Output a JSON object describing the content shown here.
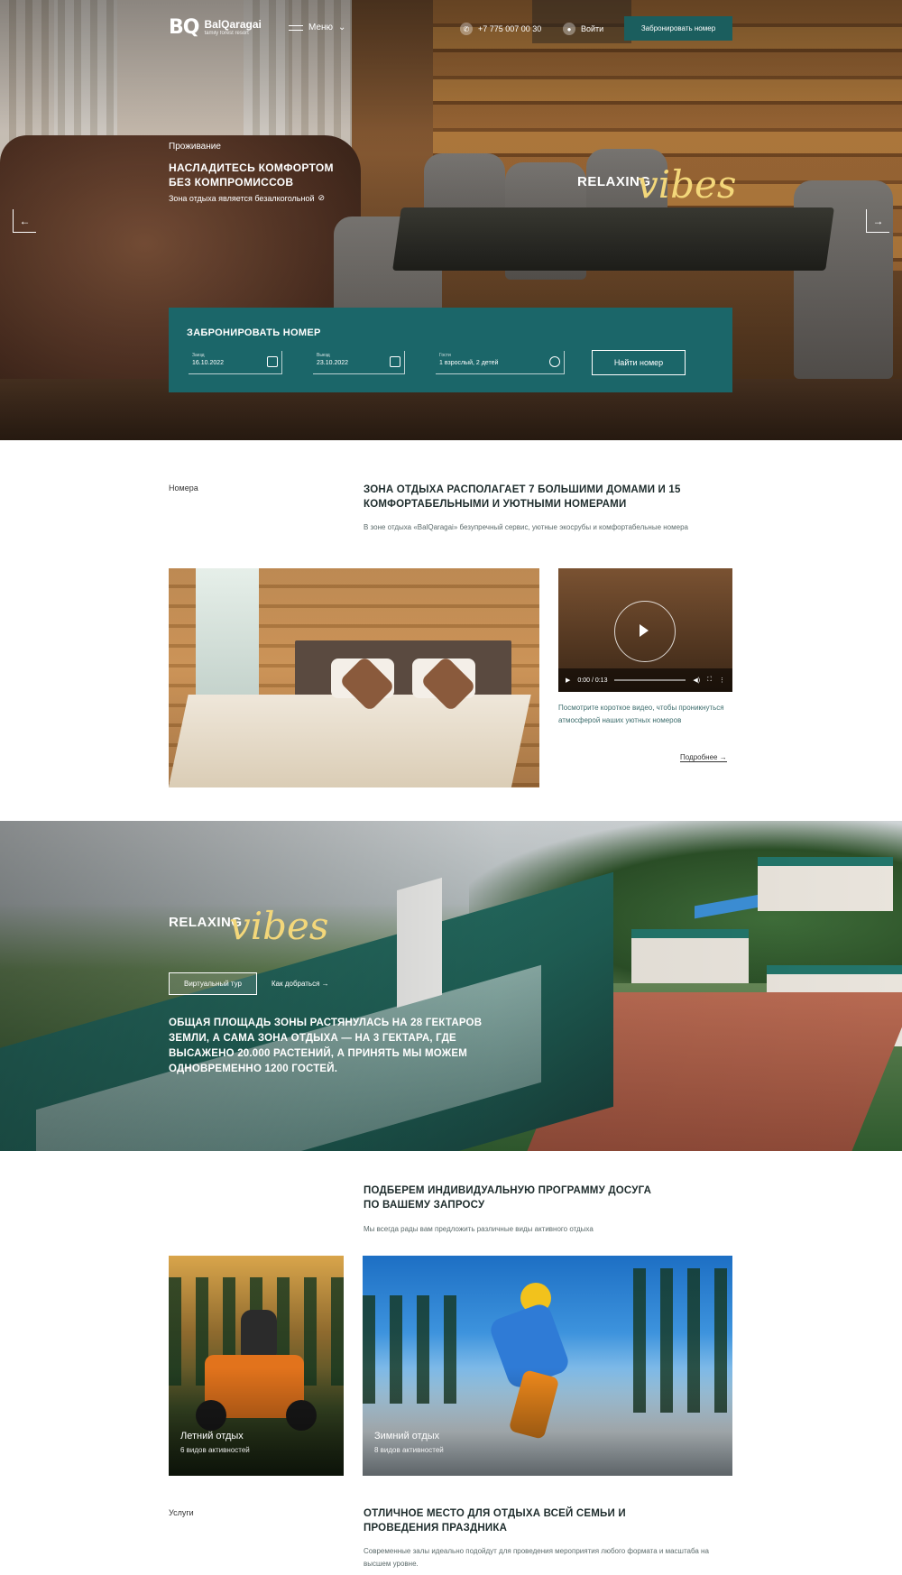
{
  "header": {
    "logo_mark": "BQ",
    "logo_name": "BalQaragai",
    "logo_sub": "family forest resort",
    "menu_label": "Меню",
    "phone": "+7 775 007 00 30",
    "login_label": "Войти",
    "book_button": "Забронировать номер"
  },
  "hero": {
    "kicker": "Проживание",
    "title": "НАСЛАДИТЕСЬ КОМФОРТОМ БЕЗ КОМПРОМИССОВ",
    "note": "Зона отдыха является безалкогольной",
    "relaxing": "RELAXING",
    "vibes": "vibes",
    "prev_arrow": "←",
    "next_arrow": "→"
  },
  "booking": {
    "title": "ЗАБРОНИРОВАТЬ НОМЕР",
    "checkin_label": "Заезд",
    "checkin_value": "16.10.2022",
    "checkout_label": "Выезд",
    "checkout_value": "23.10.2022",
    "guests_label": "Гости",
    "guests_value": "1 взрослый, 2 детей",
    "find_button": "Найти номер"
  },
  "rooms": {
    "kicker": "Номера",
    "title": "ЗОНА ОТДЫХА РАСПОЛАГАЕТ 7 БОЛЬШИМИ ДОМАМИ И 15 КОМФОРТАБЕЛЬНЫМИ И УЮТНЫМИ НОМЕРАМИ",
    "lead": "В зоне отдыха «BalQaragai» безупречный сервис, уютные экосрубы и комфортабельные номера",
    "video_time": "0:00 / 0:13",
    "video_caption": "Посмотрите короткое видео, чтобы проникнуться атмосферой наших уютных номеров",
    "more_link": "Подробнее →"
  },
  "estate": {
    "relaxing": "RELAXING",
    "vibes": "vibes",
    "tabs": [
      "Виртуальный тур",
      "Как добраться →"
    ],
    "text": "ОБЩАЯ ПЛОЩАДЬ ЗОНЫ РАСТЯНУЛАСЬ НА 28 ГЕКТАРОВ ЗЕМЛИ, А САМА ЗОНА ОТДЫХА — НА 3 ГЕКТАРА, ГДЕ ВЫСАЖЕНО 20.000 РАСТЕНИЙ, А ПРИНЯТЬ МЫ МОЖЕМ ОДНОВРЕМЕННО 1200 ГОСТЕЙ."
  },
  "leisure": {
    "title": "ПОДБЕРЕМ ИНДИВИДУАЛЬНУЮ ПРОГРАММУ ДОСУГА ПО ВАШЕМУ ЗАПРОСУ",
    "lead": "Мы всегда рады вам предложить различные виды активного отдыха",
    "cards": [
      {
        "title": "Летний отдых",
        "sub": "6 видов активностей"
      },
      {
        "title": "Зимний отдых",
        "sub": "8 видов активностей"
      }
    ]
  },
  "services": {
    "kicker": "Услуги",
    "title": "ОТЛИЧНОЕ МЕСТО ДЛЯ ОТДЫХА ВСЕЙ СЕМЬИ И ПРОВЕДЕНИЯ ПРАЗДНИКА",
    "lead": "Современные залы идеально подойдут для проведения мероприятия любого формата и масштаба на высшем уровне."
  },
  "colors": {
    "brand": "#1b6669",
    "accent": "#f3d77a"
  }
}
